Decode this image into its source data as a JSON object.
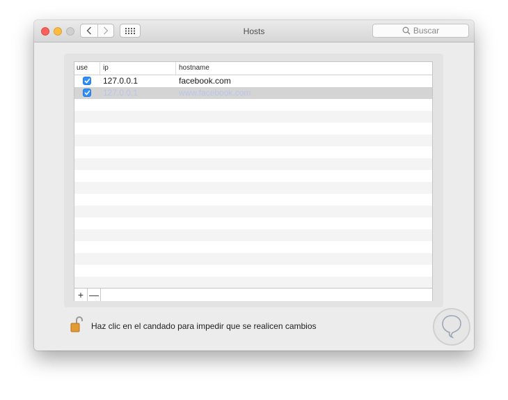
{
  "window": {
    "title": "Hosts"
  },
  "toolbar": {
    "back_icon": "chevron-left-icon",
    "forward_icon": "chevron-right-icon",
    "grid_icon": "grid-icon",
    "search_placeholder": "Buscar"
  },
  "table": {
    "columns": [
      "use",
      "ip",
      "hostname"
    ],
    "rows": [
      {
        "use": true,
        "ip": "127.0.0.1",
        "hostname": "facebook.com",
        "selected": false
      },
      {
        "use": true,
        "ip": "127.0.0.1",
        "hostname": "www.facebook.com",
        "selected": true
      }
    ],
    "add_label": "+",
    "remove_label": "—"
  },
  "footer": {
    "lock_message": "Haz clic en el candado para impedir que se realicen cambios",
    "lock_icon": "unlocked-padlock-icon",
    "help_icon": "watermark-logo-icon"
  },
  "colors": {
    "accent": "#2f8ff6",
    "selected_row": "#d4d4d4",
    "close": "#fc605b",
    "minimize": "#fdbc40",
    "zoom_disabled": "#d0d0d0"
  }
}
